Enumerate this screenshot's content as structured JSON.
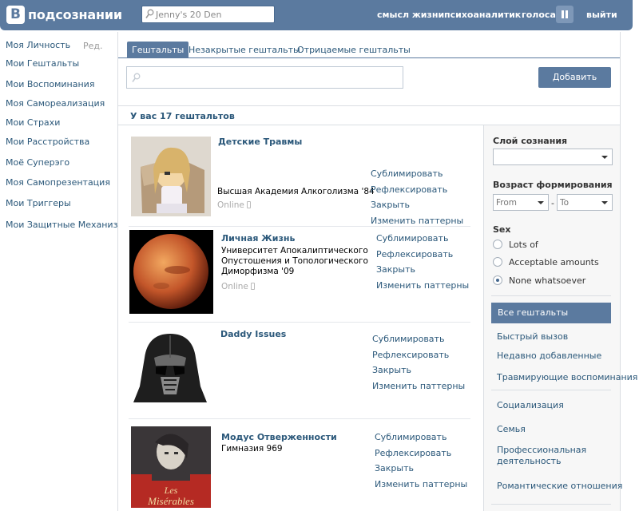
{
  "topbar": {
    "logo_letter": "В",
    "logo_text": "подсознании",
    "search_value": "Jenny's 20 Den",
    "nav": [
      "смысл жизни",
      "психоаналитик",
      "голоса",
      "выйти"
    ]
  },
  "leftmenu": {
    "edit_label": "Ред.",
    "items": [
      "Моя Личность",
      "Мои Гештальты",
      "Мои Воспоминания",
      "Моя Самореализация",
      "Мои Страхи",
      "Мои Расстройства",
      "Моё Суперэго",
      "Моя Самопрезентация",
      "Мои Триггеры",
      "Мои Защитные Механизмы"
    ]
  },
  "tabs": [
    "Гештальты",
    "Незакрытые гештальты",
    "Отрицаемые гештальты"
  ],
  "search": {
    "placeholder": ""
  },
  "add_button": "Добавить",
  "count_text": "У вас 17 гештальтов",
  "actions": [
    "Сублимировать",
    "Рефлексировать",
    "Закрыть",
    "Изменить паттерны"
  ],
  "entries": [
    {
      "name": "Детские Травмы",
      "uni": "Высшая Академия Алкоголизма '84",
      "status": "Online"
    },
    {
      "name": "Личная Жизнь",
      "uni": "Университет Апокалиптического Опустошения и Топологического Диморфизма '09",
      "status": "Online"
    },
    {
      "name": "Daddy Issues",
      "uni": "",
      "status": ""
    },
    {
      "name": "Модус Отверженности",
      "uni": "Гимназия 969",
      "status": ""
    }
  ],
  "poster_text": "Les Misérables",
  "filters": {
    "layer_label": "Слой сознания",
    "age_label": "Возраст формирования",
    "from": "From",
    "to": "To",
    "sex_label": "Sex",
    "sex_options": [
      "Lots of",
      "Acceptable amounts",
      "None whatsoever"
    ],
    "sex_selected": 2,
    "menu_active": "Все гештальты",
    "menu": [
      "Быстрый вызов",
      "Недавно добавленные",
      "Травмирующие воспоминания",
      "Социализация",
      "Семья",
      "Профессиональная деятельность",
      "Романтические отношения"
    ]
  },
  "colors": {
    "brand": "#5b7a9f",
    "link": "#2b587a"
  }
}
